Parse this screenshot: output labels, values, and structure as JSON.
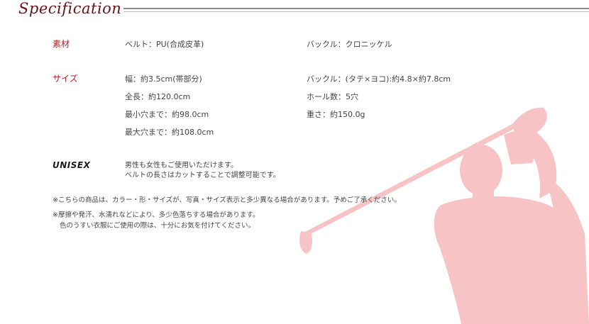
{
  "header": {
    "title": "Specification"
  },
  "material": {
    "label": "素材",
    "belt": "ベルト：PU(合成皮革)",
    "buckle": "バックル：クロニッケル"
  },
  "size": {
    "label": "サイズ",
    "width": "幅：約3.5cm(帯部分)",
    "length": "全長：約120.0cm",
    "min_hole": "最小穴まで：約98.0cm",
    "max_hole": "最大穴まで：約108.0cm",
    "buckle_dim": "バックル：(タテ×ヨコ):約4.8×約7.8cm",
    "holes": "ホール数：5穴",
    "weight": "重さ：約150.0g"
  },
  "unisex": {
    "label": "UNISEX",
    "line1": "男性も女性もご使用いただけます。",
    "line2": "ベルトの長さはカットすることで調整可能です。"
  },
  "notes": {
    "note1": "※こちらの商品は、カラー・形・サイズが、写真・サイズ表示と多少異なる場合があります。予めご了承ください。",
    "note2_line1": "※摩擦や発汗、水濡れなどにより、多少色落ちする場合があります。",
    "note2_line2": "色のうすい衣服にご使用の際は、十分にお気を付けてください。"
  },
  "colors": {
    "title": "#6b1016",
    "label": "#b01e24",
    "golfer": "#f7c3c5"
  },
  "decoration": {
    "golfer": "golfer-silhouette"
  }
}
